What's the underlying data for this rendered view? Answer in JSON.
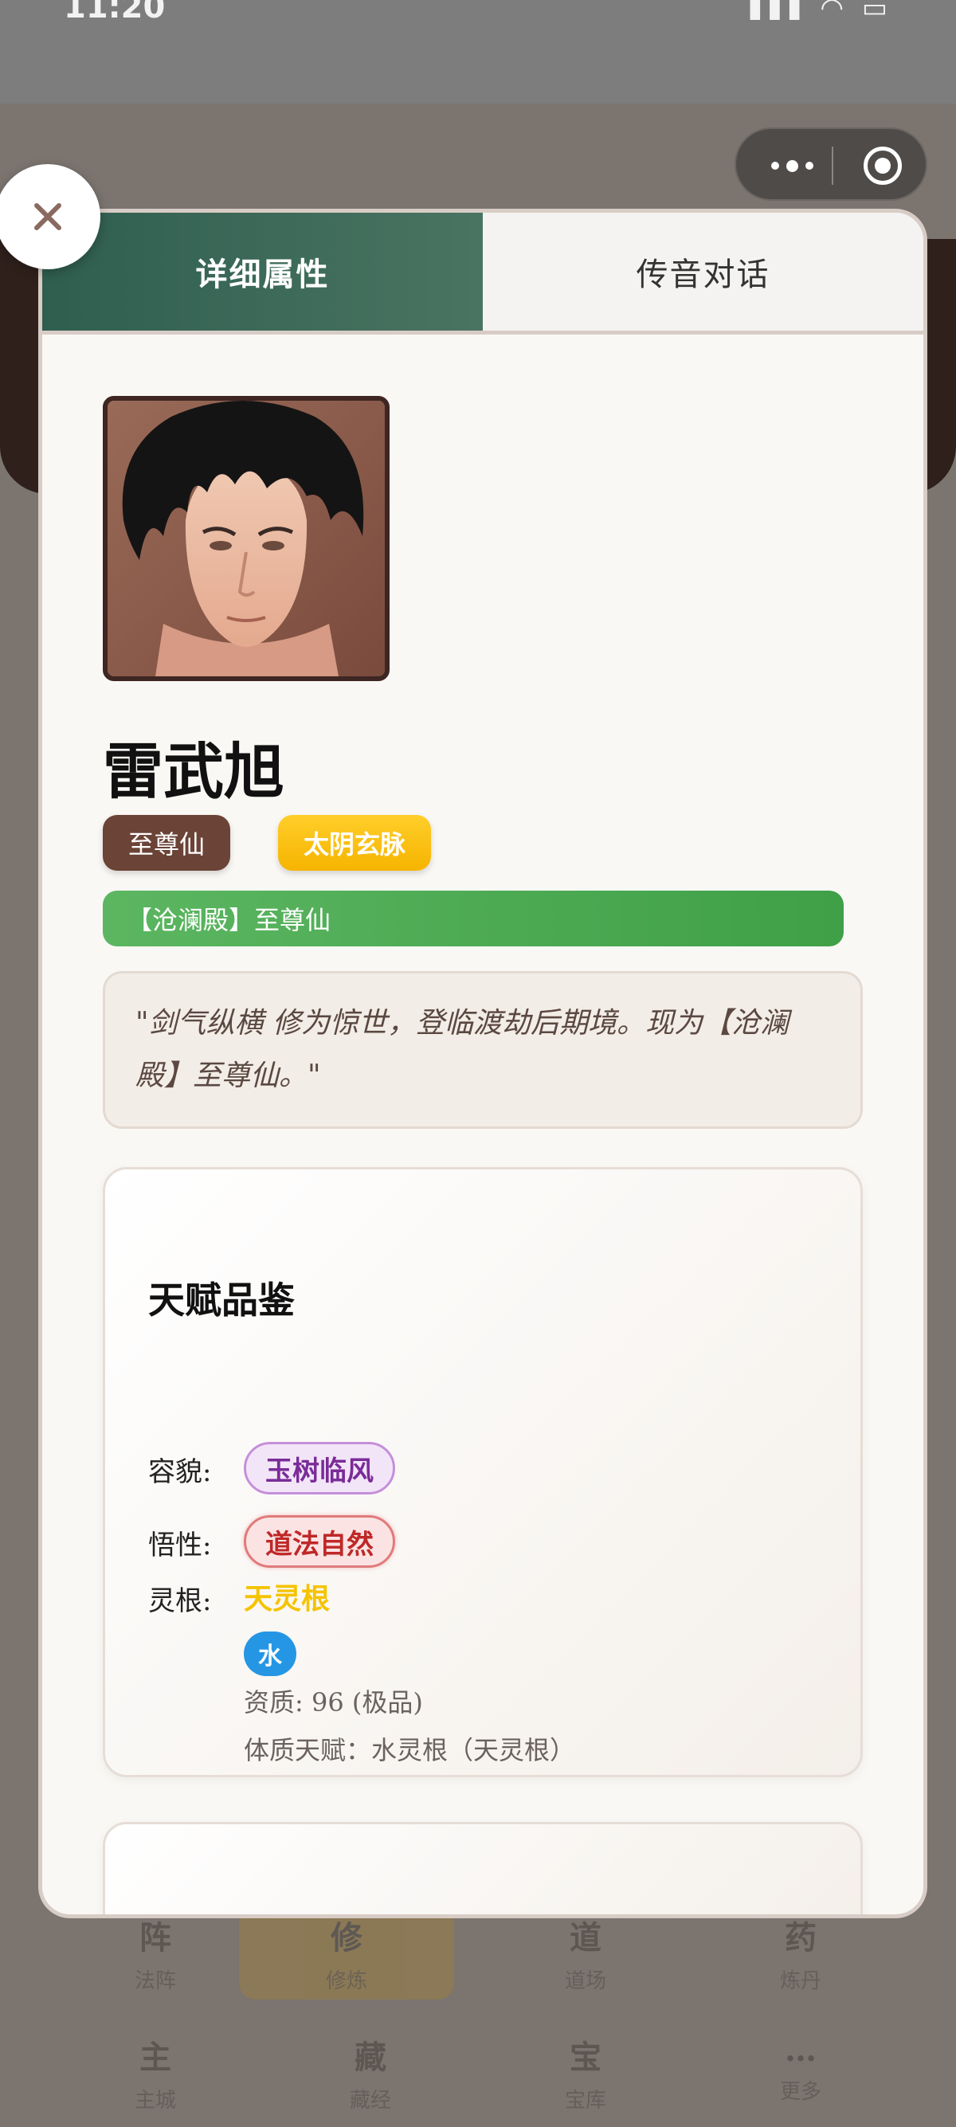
{
  "background": {
    "status_time": "11:20",
    "status_icons": "▮▮▮ ◠ ▭",
    "grid": [
      {
        "glyph": "阵",
        "sub": "法阵"
      },
      {
        "glyph": "修",
        "sub": "修炼"
      },
      {
        "glyph": "道",
        "sub": "道场"
      },
      {
        "glyph": "药",
        "sub": "炼丹"
      },
      {
        "glyph": "主",
        "sub": "主城"
      },
      {
        "glyph": "藏",
        "sub": "藏经"
      },
      {
        "glyph": "宝",
        "sub": "宝库"
      },
      {
        "glyph": "…",
        "sub": "更多"
      }
    ]
  },
  "capsule": {
    "more_icon": "more-dots-icon",
    "close_icon": "target-circle-icon"
  },
  "tabs": [
    {
      "label": "详细属性",
      "active": true
    },
    {
      "label": "传音对话",
      "active": false
    }
  ],
  "profile": {
    "name": "雷武旭",
    "rank_badge": "至尊仙",
    "vein_badge": "太阴玄脉",
    "sect_title": "【沧澜殿】至尊仙",
    "quote": "\"剑气纵横 修为惊世，登临渡劫后期境。现为【沧澜殿】至尊仙。\""
  },
  "talent": {
    "title": "天赋品鉴",
    "looks_label": "容貌:",
    "looks_value": "玉树临风",
    "wisdom_label": "悟性:",
    "wisdom_value": "道法自然",
    "root_label": "灵根:",
    "root_grade": "天灵根",
    "element": "水",
    "quality": "资质: 96 (极品)",
    "physique": "体质天赋：水灵根（天灵根）"
  },
  "colors": {
    "tab_active": "#2f5e4f",
    "rank_badge": "#6b4337",
    "vein_badge": "#f6b400",
    "sect_bar": "#4caf50",
    "looks_chip": "#7a2c98",
    "wisdom_chip": "#bf2828",
    "root_grade": "#f5c300",
    "element": "#2596e4"
  }
}
